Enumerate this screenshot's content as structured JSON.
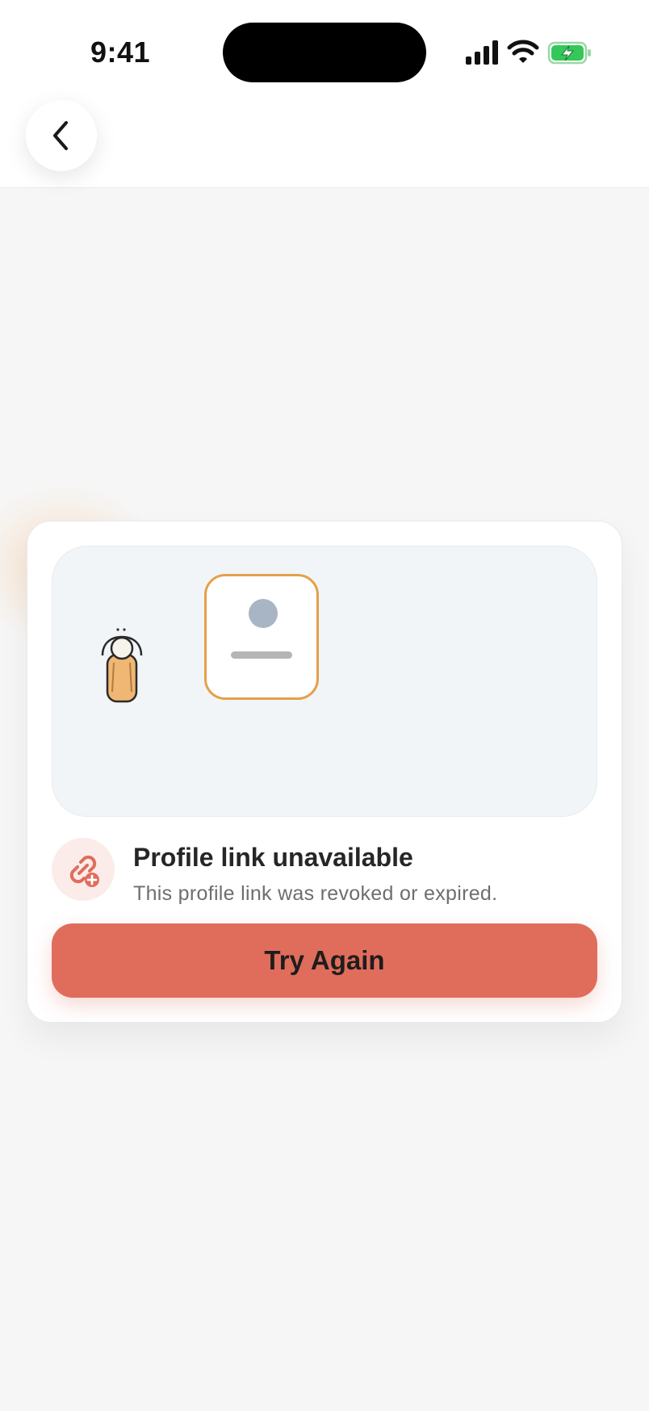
{
  "status_bar": {
    "time": "9:41",
    "icons": [
      "cellular-signal-icon",
      "wifi-icon",
      "battery-charging-icon"
    ],
    "battery_color": "#34c759"
  },
  "header": {
    "back_icon": "chevron-left-icon"
  },
  "card": {
    "illustration": {
      "accent_color": "#e4a04a",
      "elements": [
        "person-illustration",
        "profile-card-illustration"
      ]
    },
    "message": {
      "icon": "broken-link-icon",
      "title": "Profile link unavailable",
      "subtitle": "This profile link was revoked or expired."
    },
    "action": {
      "label": "Try Again",
      "color": "#e06d5b"
    }
  }
}
